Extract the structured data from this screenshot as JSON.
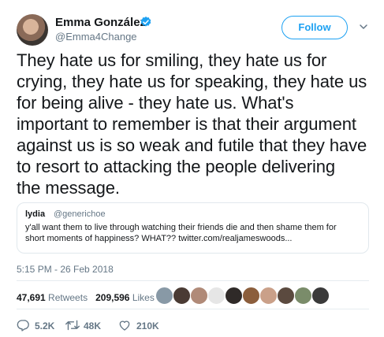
{
  "author": {
    "name": "Emma González",
    "handle": "@Emma4Change",
    "verified": true
  },
  "follow_label": "Follow",
  "tweet_lines": [
    "They hate us for smiling, they hate us for",
    "crying, they hate us for speaking, they hate us",
    "for being alive - they hate us. What's",
    "important to remember is that their argument",
    "against us is so weak and futile that they have",
    "to resort to attacking the people delivering",
    "the message."
  ],
  "quote": {
    "name": "lydia",
    "handle": "@generichoe",
    "text_lines": [
      "y'all want them to live through watching their friends die and then shame them for",
      "short moments of happiness? WHAT?? twitter.com/realjameswoods..."
    ]
  },
  "timestamp": "5:15 PM - 26 Feb 2018",
  "stats": {
    "retweets": "47,691",
    "retweets_label": "Retweets",
    "likes": "209,596",
    "likes_label": "Likes"
  },
  "liker_avatar_colors": [
    "#8899a6",
    "#4a3b34",
    "#b08a78",
    "#e6e6e6",
    "#2f2a28",
    "#8b5e3c",
    "#caa089",
    "#5b4a3f",
    "#7a8c6a",
    "#3a3a3a"
  ],
  "actions": {
    "replies": "5.2K",
    "retweets": "48K",
    "likes": "210K"
  },
  "colors": {
    "accent": "#1da1f2",
    "text": "#14171a",
    "muted": "#657786",
    "border": "#e1e8ed"
  },
  "icons": {
    "verified": "verified-badge-icon",
    "caret": "chevron-down-icon",
    "reply": "reply-icon",
    "retweet": "retweet-icon",
    "like": "heart-icon"
  }
}
